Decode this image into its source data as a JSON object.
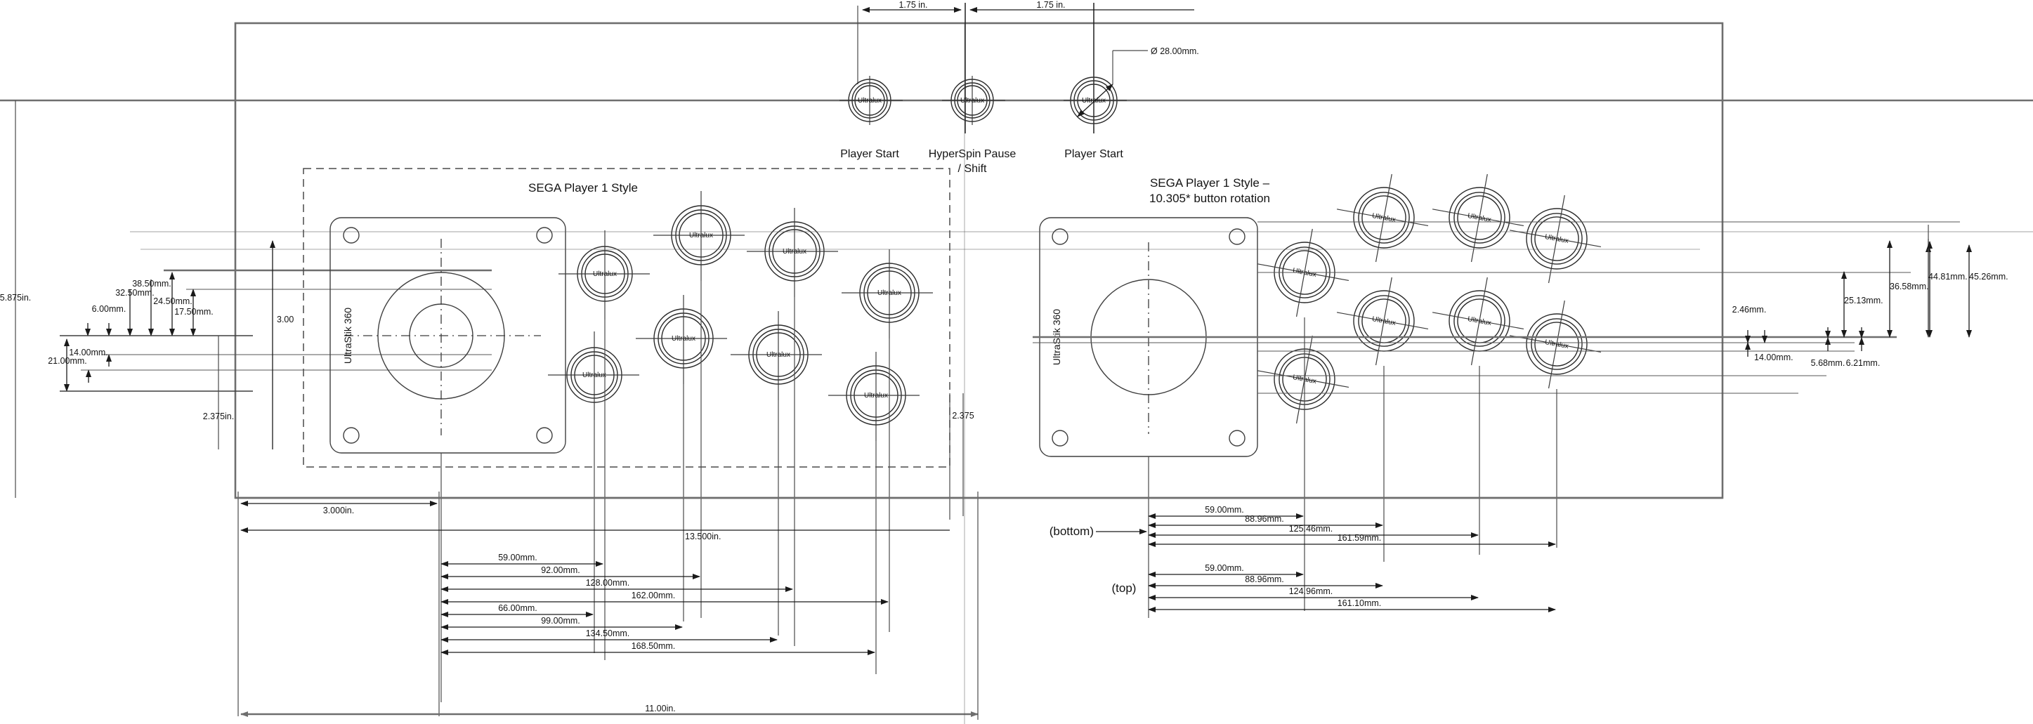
{
  "drawing": {
    "type": "arcade-control-panel-layout",
    "units_note": "mixed inch and millimeter dimensions"
  },
  "panel": {
    "overall_width_label": "11.00in.",
    "overall_height_label": "5.875in.",
    "inner_depth_label": "2.375in.",
    "left_offset_label": "3.000in.",
    "mid_width_label": "13.500in.",
    "joystick_vert_label": "3.00",
    "section_depth_label": "2.375"
  },
  "top_buttons": {
    "spacing_labels": [
      "1.75 in.",
      "1.75 in."
    ],
    "diameter_label": "Ø 28.00mm.",
    "items": [
      {
        "label": "Player Start",
        "inner_text": "Ultralux"
      },
      {
        "label": "HyperSpin Pause\n/ Shift",
        "inner_text": "Ultralux"
      },
      {
        "label": "Player Start",
        "inner_text": "Ultralux"
      }
    ],
    "item_labels": [
      "Player Start",
      "HyperSpin Pause",
      "/ Shift",
      "Player Start"
    ]
  },
  "left_cluster": {
    "title": "SEGA Player 1 Style",
    "joystick_label": "UltraStik 360",
    "button_text": "Ultralux",
    "button_count": 8,
    "vertical_dims": [
      "38.50mm.",
      "32.50mm.",
      "24.50mm.",
      "6.00mm.",
      "17.50mm.",
      "14.00mm.",
      "21.00mm."
    ],
    "horizontal_dims_top_row": [
      "59.00mm.",
      "92.00mm.",
      "128.00mm.",
      "162.00mm."
    ],
    "horizontal_dims_bottom_row": [
      "66.00mm.",
      "99.00mm.",
      "134.50mm.",
      "168.50mm."
    ]
  },
  "right_cluster": {
    "title_line1": "SEGA Player 1 Style –",
    "title_line2": "10.305* button rotation",
    "joystick_label": "UltraStik 360",
    "button_text": "Ultralux",
    "button_count": 8,
    "rotation_degrees": "10.305",
    "group_labels": {
      "bottom": "(bottom)",
      "top": "(top)"
    },
    "bottom_group_dims": [
      "59.00mm.",
      "88.96mm.",
      "125.46mm.",
      "161.59mm."
    ],
    "top_group_dims": [
      "59.00mm.",
      "88.96mm.",
      "124.96mm.",
      "161.10mm."
    ],
    "vertical_dims_right": [
      "44.81mm.",
      "45.26mm.",
      "36.58mm.",
      "25.13mm.",
      "2.46mm.",
      "14.00mm.",
      "5.68mm.",
      "6.21mm."
    ]
  },
  "colors": {
    "line": "#3f3f3f",
    "line_dark": "#1e1e1e",
    "line_gray": "#6e6e6e",
    "text": "#141414",
    "background": "#ffffff"
  }
}
